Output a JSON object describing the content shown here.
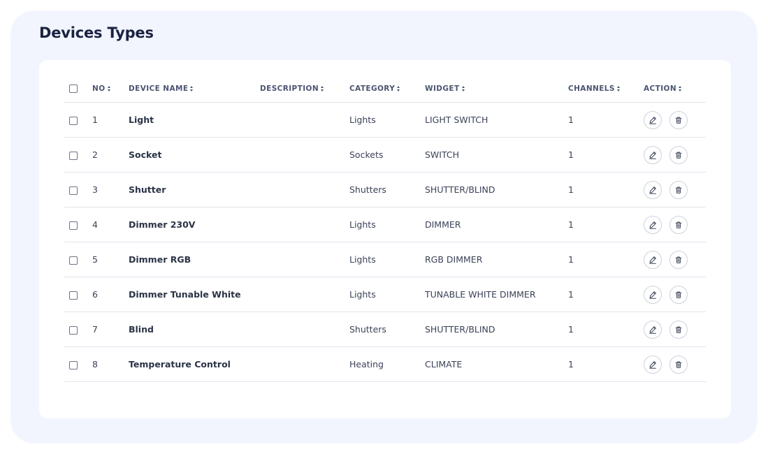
{
  "page": {
    "title": "Devices Types"
  },
  "table": {
    "headers": {
      "no": "NO",
      "device_name": "DEVICE NAME",
      "description": "DESCRIPTION",
      "category": "CATEGORY",
      "widget": "WIDGET",
      "channels": "CHANNELS",
      "action": "ACTION"
    },
    "rows": [
      {
        "no": "1",
        "name": "Light",
        "description": "",
        "category": "Lights",
        "widget": "LIGHT SWITCH",
        "channels": "1"
      },
      {
        "no": "2",
        "name": "Socket",
        "description": "",
        "category": "Sockets",
        "widget": "SWITCH",
        "channels": "1"
      },
      {
        "no": "3",
        "name": "Shutter",
        "description": "",
        "category": "Shutters",
        "widget": "SHUTTER/BLIND",
        "channels": "1"
      },
      {
        "no": "4",
        "name": "Dimmer 230V",
        "description": "",
        "category": "Lights",
        "widget": "DIMMER",
        "channels": "1"
      },
      {
        "no": "5",
        "name": "Dimmer RGB",
        "description": "",
        "category": "Lights",
        "widget": "RGB DIMMER",
        "channels": "1"
      },
      {
        "no": "6",
        "name": "Dimmer Tunable White",
        "description": "",
        "category": "Lights",
        "widget": "TUNABLE WHITE DIMMER",
        "channels": "1"
      },
      {
        "no": "7",
        "name": "Blind",
        "description": "",
        "category": "Shutters",
        "widget": "SHUTTER/BLIND",
        "channels": "1"
      },
      {
        "no": "8",
        "name": "Temperature Control",
        "description": "",
        "category": "Heating",
        "widget": "CLIMATE",
        "channels": "1"
      }
    ],
    "row_actions": [
      "edit-icon",
      "trash-icon"
    ]
  },
  "colors": {
    "panel_background": "#f2f5fe",
    "card_background": "#ffffff",
    "title_text": "#1b2240",
    "divider": "#e1e4ec"
  }
}
